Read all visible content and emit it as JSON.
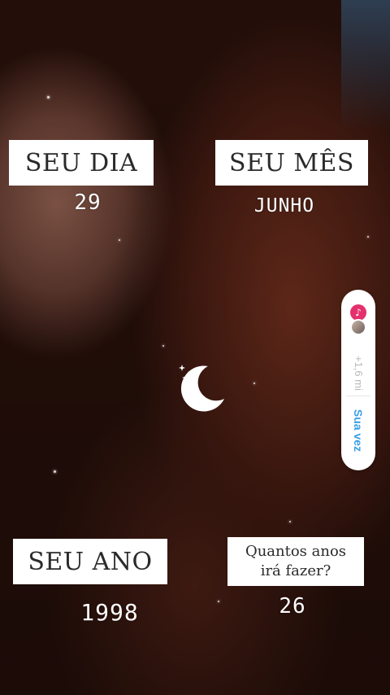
{
  "cards": {
    "day": {
      "label": "SEU DIA",
      "value": "29"
    },
    "month": {
      "label": "SEU MÊS",
      "value": "JUNHO"
    },
    "year": {
      "label": "SEU ANO",
      "value": "1998"
    },
    "age": {
      "label_line1": "Quantos anos",
      "label_line2": "irá fazer?",
      "value": "26"
    }
  },
  "side_widget": {
    "music_icon": "music-note-icon",
    "avatar": "user-avatar",
    "distance": "+1,6 mi",
    "action_label": "Sua vez"
  },
  "decoration": {
    "moon_icon": "crescent-moon-sparkle-icon"
  },
  "colors": {
    "accent_pink": "#e4306c",
    "accent_blue": "#3aa0e6",
    "label_bg": "#ffffff"
  }
}
